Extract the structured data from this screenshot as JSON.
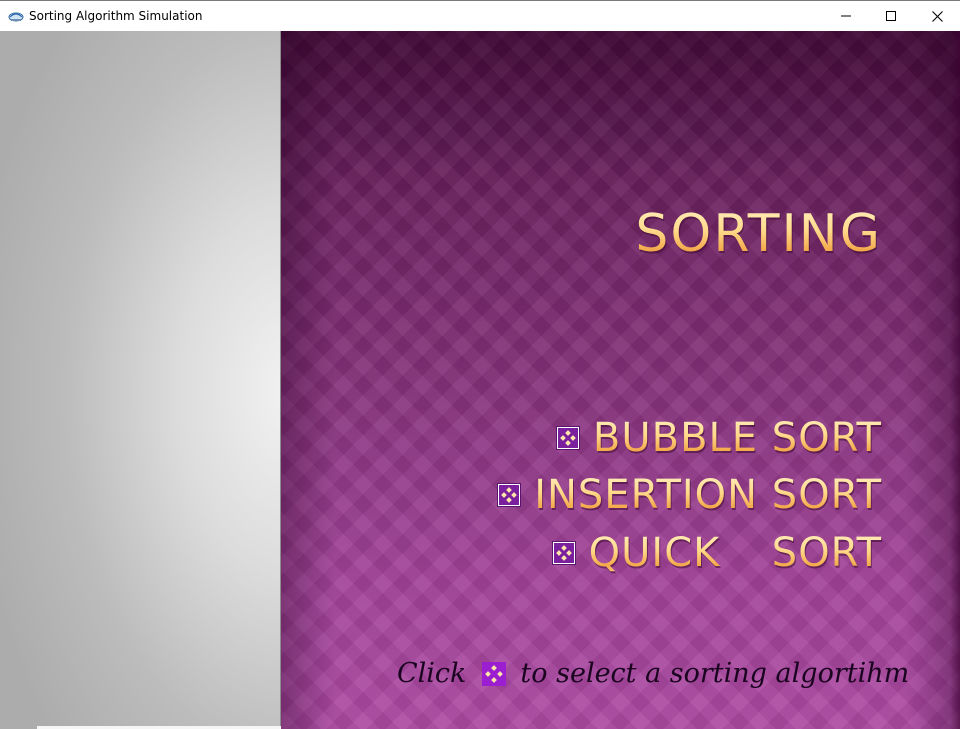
{
  "window": {
    "title": "Sorting Algorithm Simulation",
    "app_icon": "app-icon",
    "controls": {
      "minimize_icon": "minimize-icon",
      "maximize_icon": "maximize-icon",
      "close_icon": "close-icon"
    }
  },
  "slide": {
    "title": "SORTING",
    "items": [
      {
        "label": "BUBBLE SORT",
        "icon": "diamond-bullet-icon"
      },
      {
        "label": "INSERTION SORT",
        "icon": "diamond-bullet-icon"
      },
      {
        "label": "QUICK  SORT",
        "icon": "diamond-bullet-icon"
      }
    ],
    "instruction": {
      "before": "Click",
      "icon": "diamond-bullet-icon",
      "after": "to select a sorting algortihm"
    }
  },
  "colors": {
    "slide_background": "#8a3580",
    "title_gold": "#ffd98a",
    "bullet_purple": "#7a1f9e",
    "instruction_text": "#1a0420",
    "left_panel": "#c8c8c8"
  }
}
